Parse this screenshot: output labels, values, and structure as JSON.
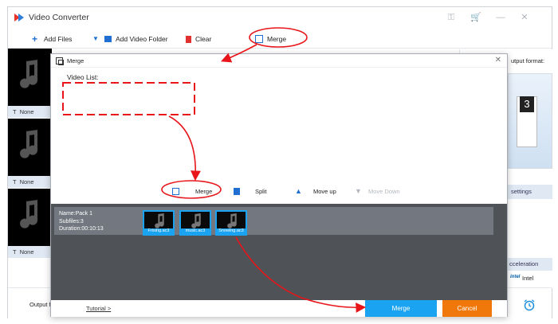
{
  "app": {
    "title": "Video Converter",
    "icons": [
      "key-icon",
      "cart-icon",
      "minimize-icon",
      "close-icon"
    ]
  },
  "toolbar": {
    "add_files": "Add Files",
    "add_video_folder": "Add Video Folder",
    "clear": "Clear",
    "merge": "Merge"
  },
  "file_list": {
    "items": [
      {
        "subtitle": "None"
      },
      {
        "subtitle": "None"
      },
      {
        "subtitle": "None"
      }
    ]
  },
  "right_panel": {
    "output_format": "utput format:",
    "format_number": "3",
    "settings": "settings",
    "acceleration": "cceleration",
    "intel_logo": "intel",
    "intel": "Intel"
  },
  "bottom_bar": {
    "output_label": "Output fo"
  },
  "merge_dialog": {
    "title": "Merge",
    "video_list_label": "Video List:",
    "actions": {
      "merge": "Merge",
      "split": "Split",
      "move_up": "Move up",
      "move_down": "Move Down"
    },
    "pack": {
      "name": "Name:Pack 1",
      "subfiles": "Subfiles:3",
      "duration": "Duration:00:10:13",
      "clips": [
        {
          "name": "Frising.ac3"
        },
        {
          "name": "music.ac3"
        },
        {
          "name": "Snowing.ac3"
        }
      ]
    },
    "footer": {
      "tutorial": "Tutorial >",
      "merge_button": "Merge",
      "cancel_button": "Cancel"
    }
  },
  "colors": {
    "accent_blue": "#1aa3f0",
    "cancel_orange": "#f0780a",
    "annotation_red": "#e8161b",
    "pack_area": "#4f5257",
    "pack_row": "#737880"
  }
}
